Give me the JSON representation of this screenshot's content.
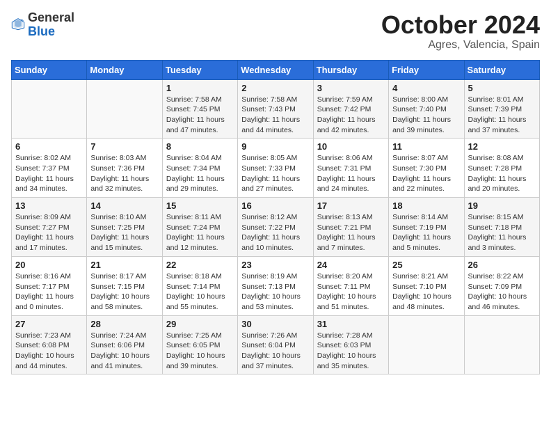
{
  "logo": {
    "text_general": "General",
    "text_blue": "Blue"
  },
  "title": "October 2024",
  "subtitle": "Agres, Valencia, Spain",
  "weekdays": [
    "Sunday",
    "Monday",
    "Tuesday",
    "Wednesday",
    "Thursday",
    "Friday",
    "Saturday"
  ],
  "weeks": [
    [
      null,
      null,
      {
        "day": 1,
        "sunrise": "7:58 AM",
        "sunset": "7:45 PM",
        "daylight": "11 hours and 47 minutes."
      },
      {
        "day": 2,
        "sunrise": "7:58 AM",
        "sunset": "7:43 PM",
        "daylight": "11 hours and 44 minutes."
      },
      {
        "day": 3,
        "sunrise": "7:59 AM",
        "sunset": "7:42 PM",
        "daylight": "11 hours and 42 minutes."
      },
      {
        "day": 4,
        "sunrise": "8:00 AM",
        "sunset": "7:40 PM",
        "daylight": "11 hours and 39 minutes."
      },
      {
        "day": 5,
        "sunrise": "8:01 AM",
        "sunset": "7:39 PM",
        "daylight": "11 hours and 37 minutes."
      }
    ],
    [
      {
        "day": 6,
        "sunrise": "8:02 AM",
        "sunset": "7:37 PM",
        "daylight": "11 hours and 34 minutes."
      },
      {
        "day": 7,
        "sunrise": "8:03 AM",
        "sunset": "7:36 PM",
        "daylight": "11 hours and 32 minutes."
      },
      {
        "day": 8,
        "sunrise": "8:04 AM",
        "sunset": "7:34 PM",
        "daylight": "11 hours and 29 minutes."
      },
      {
        "day": 9,
        "sunrise": "8:05 AM",
        "sunset": "7:33 PM",
        "daylight": "11 hours and 27 minutes."
      },
      {
        "day": 10,
        "sunrise": "8:06 AM",
        "sunset": "7:31 PM",
        "daylight": "11 hours and 24 minutes."
      },
      {
        "day": 11,
        "sunrise": "8:07 AM",
        "sunset": "7:30 PM",
        "daylight": "11 hours and 22 minutes."
      },
      {
        "day": 12,
        "sunrise": "8:08 AM",
        "sunset": "7:28 PM",
        "daylight": "11 hours and 20 minutes."
      }
    ],
    [
      {
        "day": 13,
        "sunrise": "8:09 AM",
        "sunset": "7:27 PM",
        "daylight": "11 hours and 17 minutes."
      },
      {
        "day": 14,
        "sunrise": "8:10 AM",
        "sunset": "7:25 PM",
        "daylight": "11 hours and 15 minutes."
      },
      {
        "day": 15,
        "sunrise": "8:11 AM",
        "sunset": "7:24 PM",
        "daylight": "11 hours and 12 minutes."
      },
      {
        "day": 16,
        "sunrise": "8:12 AM",
        "sunset": "7:22 PM",
        "daylight": "11 hours and 10 minutes."
      },
      {
        "day": 17,
        "sunrise": "8:13 AM",
        "sunset": "7:21 PM",
        "daylight": "11 hours and 7 minutes."
      },
      {
        "day": 18,
        "sunrise": "8:14 AM",
        "sunset": "7:19 PM",
        "daylight": "11 hours and 5 minutes."
      },
      {
        "day": 19,
        "sunrise": "8:15 AM",
        "sunset": "7:18 PM",
        "daylight": "11 hours and 3 minutes."
      }
    ],
    [
      {
        "day": 20,
        "sunrise": "8:16 AM",
        "sunset": "7:17 PM",
        "daylight": "11 hours and 0 minutes."
      },
      {
        "day": 21,
        "sunrise": "8:17 AM",
        "sunset": "7:15 PM",
        "daylight": "10 hours and 58 minutes."
      },
      {
        "day": 22,
        "sunrise": "8:18 AM",
        "sunset": "7:14 PM",
        "daylight": "10 hours and 55 minutes."
      },
      {
        "day": 23,
        "sunrise": "8:19 AM",
        "sunset": "7:13 PM",
        "daylight": "10 hours and 53 minutes."
      },
      {
        "day": 24,
        "sunrise": "8:20 AM",
        "sunset": "7:11 PM",
        "daylight": "10 hours and 51 minutes."
      },
      {
        "day": 25,
        "sunrise": "8:21 AM",
        "sunset": "7:10 PM",
        "daylight": "10 hours and 48 minutes."
      },
      {
        "day": 26,
        "sunrise": "8:22 AM",
        "sunset": "7:09 PM",
        "daylight": "10 hours and 46 minutes."
      }
    ],
    [
      {
        "day": 27,
        "sunrise": "7:23 AM",
        "sunset": "6:08 PM",
        "daylight": "10 hours and 44 minutes."
      },
      {
        "day": 28,
        "sunrise": "7:24 AM",
        "sunset": "6:06 PM",
        "daylight": "10 hours and 41 minutes."
      },
      {
        "day": 29,
        "sunrise": "7:25 AM",
        "sunset": "6:05 PM",
        "daylight": "10 hours and 39 minutes."
      },
      {
        "day": 30,
        "sunrise": "7:26 AM",
        "sunset": "6:04 PM",
        "daylight": "10 hours and 37 minutes."
      },
      {
        "day": 31,
        "sunrise": "7:28 AM",
        "sunset": "6:03 PM",
        "daylight": "10 hours and 35 minutes."
      },
      null,
      null
    ]
  ]
}
